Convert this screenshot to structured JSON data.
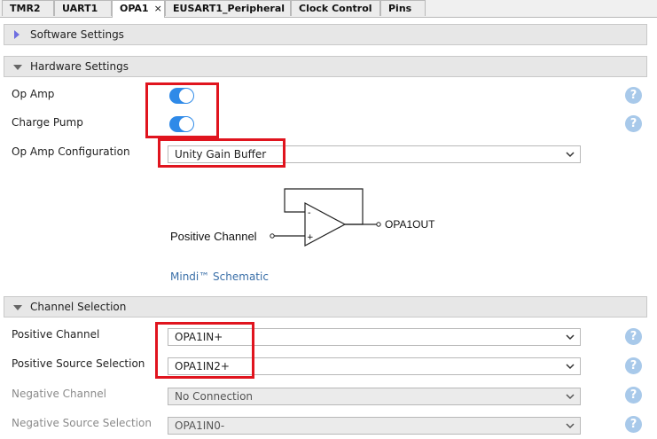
{
  "tabs": [
    {
      "label": "TMR2"
    },
    {
      "label": "UART1"
    },
    {
      "label": "OPA1",
      "close": "×"
    },
    {
      "label": "EUSART1_Peripheral"
    },
    {
      "label": "Clock Control"
    },
    {
      "label": "Pins"
    }
  ],
  "sections": {
    "software": "Software Settings",
    "hardware": "Hardware Settings",
    "channel": "Channel Selection"
  },
  "hardware": {
    "op_amp_label": "Op Amp",
    "op_amp_enabled": true,
    "charge_pump_label": "Charge Pump",
    "charge_pump_enabled": true,
    "config_label": "Op Amp Configuration",
    "config_value": "Unity Gain Buffer"
  },
  "schematic": {
    "input_label": "Positive Channel",
    "output_label": "OPA1OUT",
    "minus_sign": "-",
    "plus_sign": "+",
    "link_text": "Mindi™ Schematic"
  },
  "channel": {
    "positive_channel_label": "Positive Channel",
    "positive_channel_value": "OPA1IN+",
    "positive_source_label": "Positive Source Selection",
    "positive_source_value": "OPA1IN2+",
    "negative_channel_label": "Negative Channel",
    "negative_channel_value": "No Connection",
    "negative_source_label": "Negative Source Selection",
    "negative_source_value": "OPA1IN0-"
  },
  "help_symbol": "?",
  "colors": {
    "toggle_on": "#2f8ae8",
    "help_icon": "#a8c9ea",
    "highlight": "#e0141e",
    "link": "#3a6fa8"
  }
}
